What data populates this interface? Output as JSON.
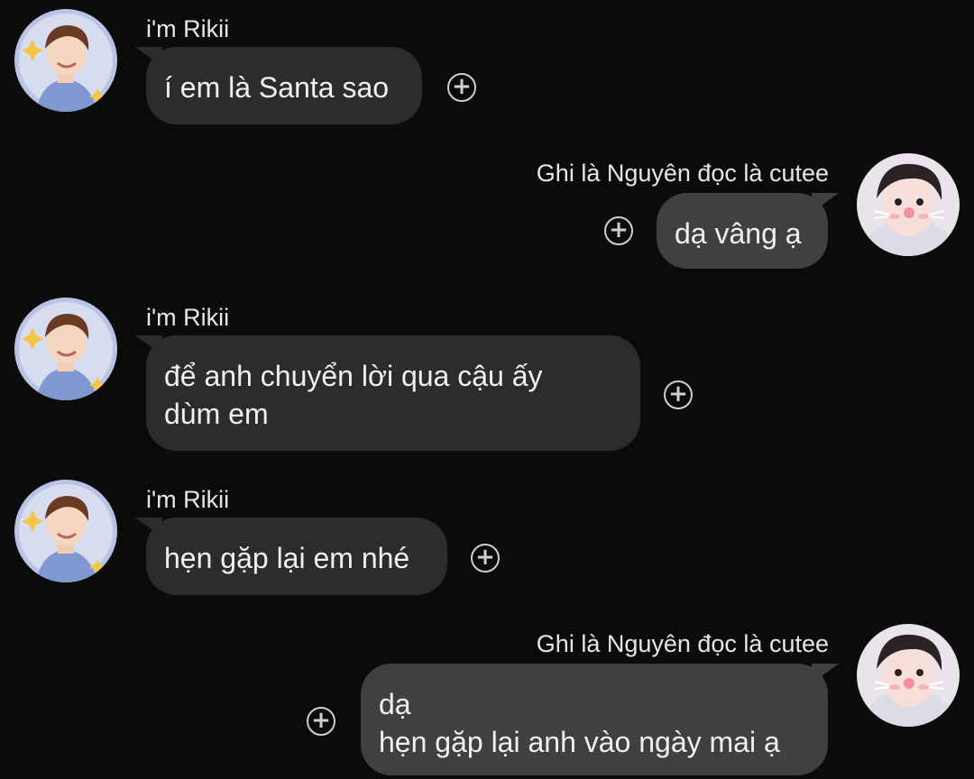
{
  "messages": [
    {
      "side": "left",
      "sender": "i'm Rikii",
      "text": "í em là Santa sao"
    },
    {
      "side": "right",
      "sender": "Ghi là Nguyên đọc là cutee",
      "text": "dạ vâng ạ"
    },
    {
      "side": "left",
      "sender": "i'm Rikii",
      "text": "để anh chuyển lời qua cậu ấy\ndùm em"
    },
    {
      "side": "left",
      "sender": "i'm Rikii",
      "text": "hẹn gặp lại em nhé"
    },
    {
      "side": "right",
      "sender": "Ghi là Nguyên đọc là cutee",
      "text": "dạ\nhẹn gặp lại anh vào ngày mai ạ"
    }
  ],
  "icons": {
    "reaction": "add-reaction-icon",
    "avatar_left": "avatar-rikii",
    "avatar_right": "avatar-nguyen"
  },
  "colors": {
    "background": "#0b0b0b",
    "bubble_received": "#2c2c2c",
    "bubble_sent": "#404040",
    "text": "#f0f0f0"
  }
}
